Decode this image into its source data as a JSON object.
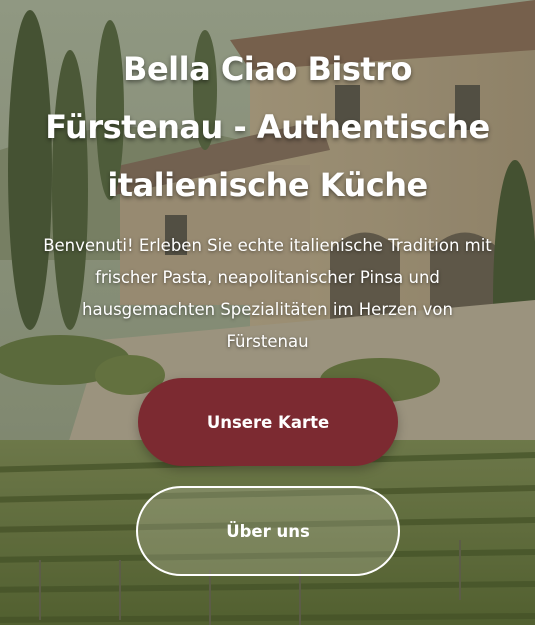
{
  "hero": {
    "title": "Bella Ciao Bistro Fürstenau - Authentische italienische Küche",
    "subtitle": "Benvenuti! Erleben Sie echte italienische Tradition mit frischer Pasta, neapolitanischer Pinsa und hausgemachten Spezialitäten im Herzen von Fürstenau",
    "primary_button_label": "Unsere Karte",
    "secondary_button_label": "Über uns"
  },
  "colors": {
    "primary_button": "#7c2a31",
    "text": "#ffffff"
  }
}
